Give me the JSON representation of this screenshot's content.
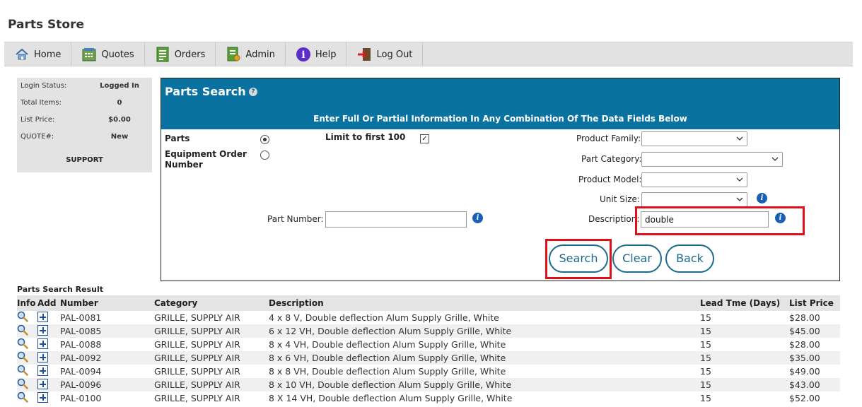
{
  "app": {
    "title": "Parts Store"
  },
  "nav": [
    {
      "label": "Home",
      "icon": "home-icon"
    },
    {
      "label": "Quotes",
      "icon": "quotes-icon"
    },
    {
      "label": "Orders",
      "icon": "orders-icon"
    },
    {
      "label": "Admin",
      "icon": "admin-icon"
    },
    {
      "label": "Help",
      "icon": "help-icon"
    },
    {
      "label": "Log Out",
      "icon": "logout-icon"
    }
  ],
  "status": {
    "rows": [
      {
        "label": "Login Status:",
        "value": "Logged In"
      },
      {
        "label": "Total Items:",
        "value": "0"
      },
      {
        "label": "List Price:",
        "value": "$0.00"
      },
      {
        "label": "QUOTE#:",
        "value": "New"
      }
    ],
    "support": "SUPPORT"
  },
  "search": {
    "title": "Parts Search",
    "help": "?",
    "subtitle": "Enter Full Or Partial Information In Any Combination Of The Data Fields Below",
    "parts_label": "Parts",
    "equipment_label_1": "Equipment Order",
    "equipment_label_2": "Number",
    "limit_label": "Limit to first 100",
    "product_family_label": "Product Family:",
    "part_category_label": "Part Category:",
    "product_model_label": "Product Model:",
    "unit_size_label": "Unit Size:",
    "part_number_label": "Part Number:",
    "part_number_value": "",
    "description_label": "Description:",
    "description_value": "double",
    "info": "i",
    "search_button": "Search",
    "clear_button": "Clear",
    "back_button": "Back"
  },
  "results": {
    "title": "Parts Search Result",
    "headers": {
      "info": "Info",
      "add": "Add",
      "number": "Number",
      "category": "Category",
      "description": "Description",
      "lead": "Lead Tme (Days)",
      "price": "List Price"
    },
    "rows": [
      {
        "number": "PAL-0081",
        "category": "GRILLE, SUPPLY AIR",
        "description": "4 x 8 V, Double deflection Alum Supply Grille, White",
        "lead": "15",
        "price": "$28.00"
      },
      {
        "number": "PAL-0085",
        "category": "GRILLE, SUPPLY AIR",
        "description": "6 x 12 VH, Double deflection Alum Supply Grille, White",
        "lead": "15",
        "price": "$45.00"
      },
      {
        "number": "PAL-0088",
        "category": "GRILLE, SUPPLY AIR",
        "description": "8 x 4 VH, Double deflection Alum Supply Grille, White",
        "lead": "15",
        "price": "$28.00"
      },
      {
        "number": "PAL-0092",
        "category": "GRILLE, SUPPLY AIR",
        "description": "8 x 6 VH, Double deflection Alum Supply Grille, White",
        "lead": "15",
        "price": "$35.00"
      },
      {
        "number": "PAL-0094",
        "category": "GRILLE, SUPPLY AIR",
        "description": "8 x 8 VH, Double deflection Alum Supply Grille, White",
        "lead": "15",
        "price": "$49.00"
      },
      {
        "number": "PAL-0096",
        "category": "GRILLE, SUPPLY AIR",
        "description": "8 x 10 VH, Double deflection Alum Supply Grille, White",
        "lead": "15",
        "price": "$43.00"
      },
      {
        "number": "PAL-0100",
        "category": "GRILLE, SUPPLY AIR",
        "description": "8 X 14 VH, Double deflection Alum Supply Grille, White",
        "lead": "15",
        "price": "$52.00"
      }
    ]
  },
  "colors": {
    "header_blue": "#0a72a0",
    "button_teal": "#1b6b8c",
    "highlight_red": "#e0101b"
  }
}
